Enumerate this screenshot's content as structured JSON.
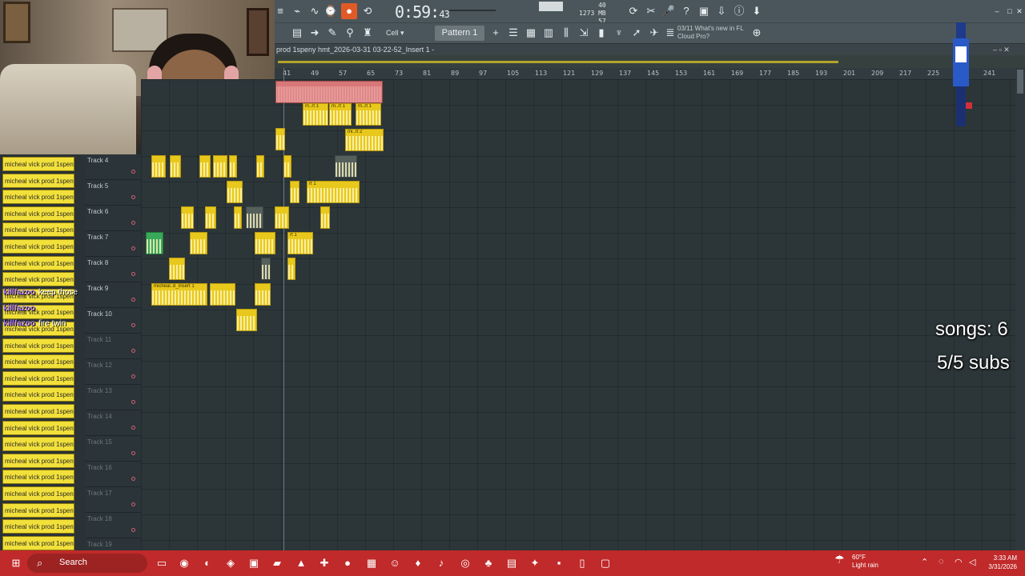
{
  "toolbar": {
    "time_main": "0:59:",
    "time_small": "43",
    "memory_top": "40",
    "memory_mb": "1273 MB",
    "memory_bottom": "57",
    "snap": "Cell",
    "pattern": "Pattern 1",
    "news_line1": "03/11  What's new in FL",
    "news_line2": "Cloud Pro?"
  },
  "playlist": {
    "title": "prod 1speny hmt_2026-03-31 03-22-52_Insert 1 -",
    "ruler": [
      "41",
      "49",
      "57",
      "65",
      "73",
      "81",
      "89",
      "97",
      "105",
      "113",
      "121",
      "129",
      "137",
      "145",
      "153",
      "161",
      "169",
      "177",
      "185",
      "193",
      "201",
      "209",
      "217",
      "225",
      "241"
    ]
  },
  "tracks": [
    {
      "name": "Track 4",
      "active": true
    },
    {
      "name": "Track 5",
      "active": true
    },
    {
      "name": "Track 6",
      "active": true
    },
    {
      "name": "Track 7",
      "active": true
    },
    {
      "name": "Track 8",
      "active": true
    },
    {
      "name": "Track 9",
      "active": true
    },
    {
      "name": "Track 10",
      "active": true
    },
    {
      "name": "Track 11",
      "active": false
    },
    {
      "name": "Track 12",
      "active": false
    },
    {
      "name": "Track 13",
      "active": false
    },
    {
      "name": "Track 14",
      "active": false
    },
    {
      "name": "Track 15",
      "active": false
    },
    {
      "name": "Track 16",
      "active": false
    },
    {
      "name": "Track 17",
      "active": false
    },
    {
      "name": "Track 18",
      "active": false
    },
    {
      "name": "Track 19",
      "active": false
    }
  ],
  "channels": {
    "label": "micheal vick prod 1speny"
  },
  "clips": {
    "label_a": "m..rt 1",
    "label_b": "mi..rt 2",
    "label_c": "micheal..8_Insert 1",
    "label_d": "rt 1"
  },
  "chat": [
    {
      "user": "killfazoo",
      "message": "keep those"
    },
    {
      "user": "killfazoo",
      "message": ""
    },
    {
      "user": "killfazoo",
      "message": "fire twin"
    }
  ],
  "overlay": {
    "songs": "songs: 6",
    "subs": "5/5 subs"
  },
  "taskbar": {
    "search": "Search",
    "weather_temp": "60°F",
    "weather_desc": "Light rain",
    "time": "3:33 AM",
    "date": "3/31/2026"
  },
  "colors": {
    "clip": "#e8c81c",
    "taskbar": "#c02a2a",
    "record": "#e05a28"
  }
}
